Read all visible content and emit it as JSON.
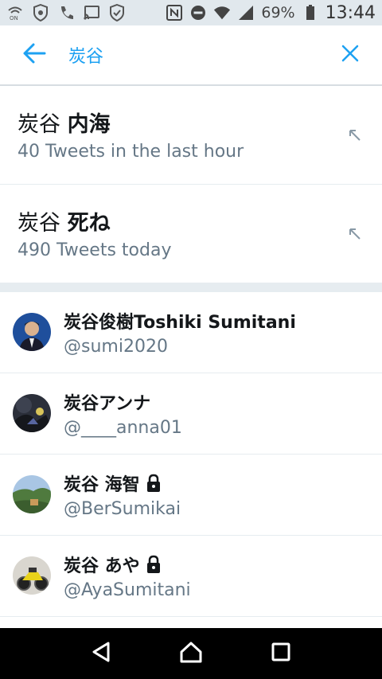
{
  "status_bar": {
    "battery_percent": "69%",
    "time": "13:44",
    "icons": [
      "wifi-calling-icon",
      "shield-icon",
      "phone-icon",
      "cast-icon",
      "shield-check-icon",
      "nfc-icon",
      "do-not-disturb-icon",
      "wifi-icon",
      "signal-icon",
      "battery-icon"
    ]
  },
  "header": {
    "query": "炭谷",
    "back_icon": "arrow-left-icon",
    "close_icon": "close-icon"
  },
  "trends": [
    {
      "prefix": "炭谷 ",
      "bold": "内海",
      "subtitle": "40 Tweets in the last hour"
    },
    {
      "prefix": "炭谷 ",
      "bold": "死ね",
      "subtitle": "490 Tweets today"
    }
  ],
  "users": [
    {
      "name": "炭谷俊樹Toshiki Sumitani",
      "handle": "@sumi2020",
      "protected": false
    },
    {
      "name": "炭谷アンナ",
      "handle": "@____anna01",
      "protected": false
    },
    {
      "name": "炭谷 海智",
      "handle": "@BerSumikai",
      "protected": true
    },
    {
      "name": "炭谷 あや",
      "handle": "@AyaSumitani",
      "protected": true
    }
  ],
  "colors": {
    "accent": "#1da1f2",
    "secondary_text": "#657786",
    "divider": "#e6ecf0"
  },
  "nav": [
    "back-triangle-icon",
    "home-icon",
    "recents-square-icon"
  ]
}
